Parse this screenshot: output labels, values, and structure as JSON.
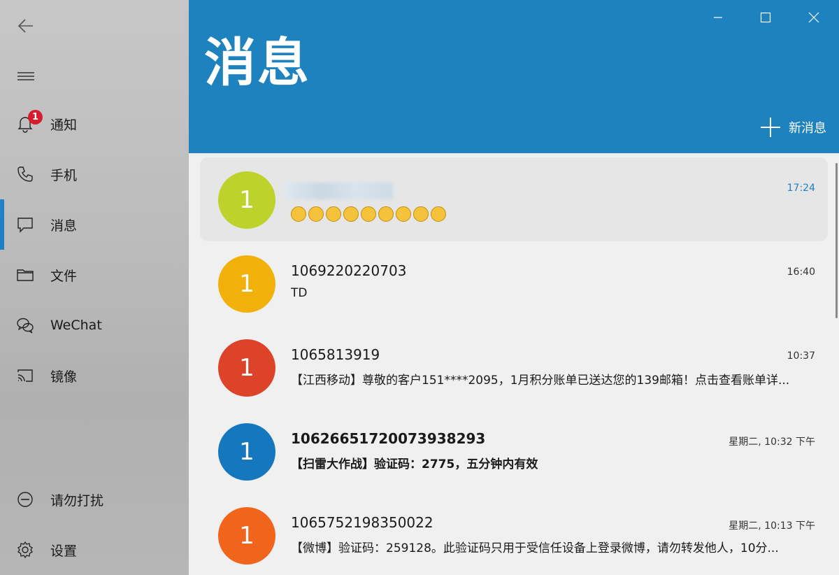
{
  "window": {
    "title": "消息",
    "new_message_label": "新消息"
  },
  "sidebar": {
    "items": [
      {
        "label": "通知",
        "icon": "bell-icon",
        "badge": "1"
      },
      {
        "label": "手机",
        "icon": "phone-icon"
      },
      {
        "label": "消息",
        "icon": "message-icon",
        "active": true
      },
      {
        "label": "文件",
        "icon": "folder-icon"
      },
      {
        "label": "WeChat",
        "icon": "wechat-icon"
      },
      {
        "label": "镜像",
        "icon": "cast-icon"
      }
    ],
    "bottom": [
      {
        "label": "请勿打扰",
        "icon": "do-not-disturb-icon"
      },
      {
        "label": "设置",
        "icon": "gear-icon"
      }
    ]
  },
  "colors": {
    "accent": "#1e82bf",
    "badge": "#d51d2e"
  },
  "messages": [
    {
      "avatar": "1",
      "avatar_color": "#bdd22a",
      "sender": "",
      "preview_emojis": 9,
      "time": "17:24",
      "selected": true
    },
    {
      "avatar": "1",
      "avatar_color": "#f2b00a",
      "sender": "1069220220703",
      "preview": "TD",
      "time": "16:40"
    },
    {
      "avatar": "1",
      "avatar_color": "#dc4329",
      "sender": "1065813919",
      "preview": "【江西移动】尊敬的客户151****2095，1月积分账单已送达您的139邮箱！点击查看账单详...",
      "time": "10:37"
    },
    {
      "avatar": "1",
      "avatar_color": "#1577bd",
      "sender": "10626651720073938293",
      "preview": "【扫雷大作战】验证码：2775，五分钟内有效",
      "time": "星期二, 10:32 下午",
      "unread": true
    },
    {
      "avatar": "1",
      "avatar_color": "#f0641c",
      "sender": "1065752198350022",
      "preview": "【微博】验证码：259128。此验证码只用于受信任设备上登录微博，请勿转发他人，10分...",
      "time": "星期二, 10:13 下午"
    }
  ]
}
